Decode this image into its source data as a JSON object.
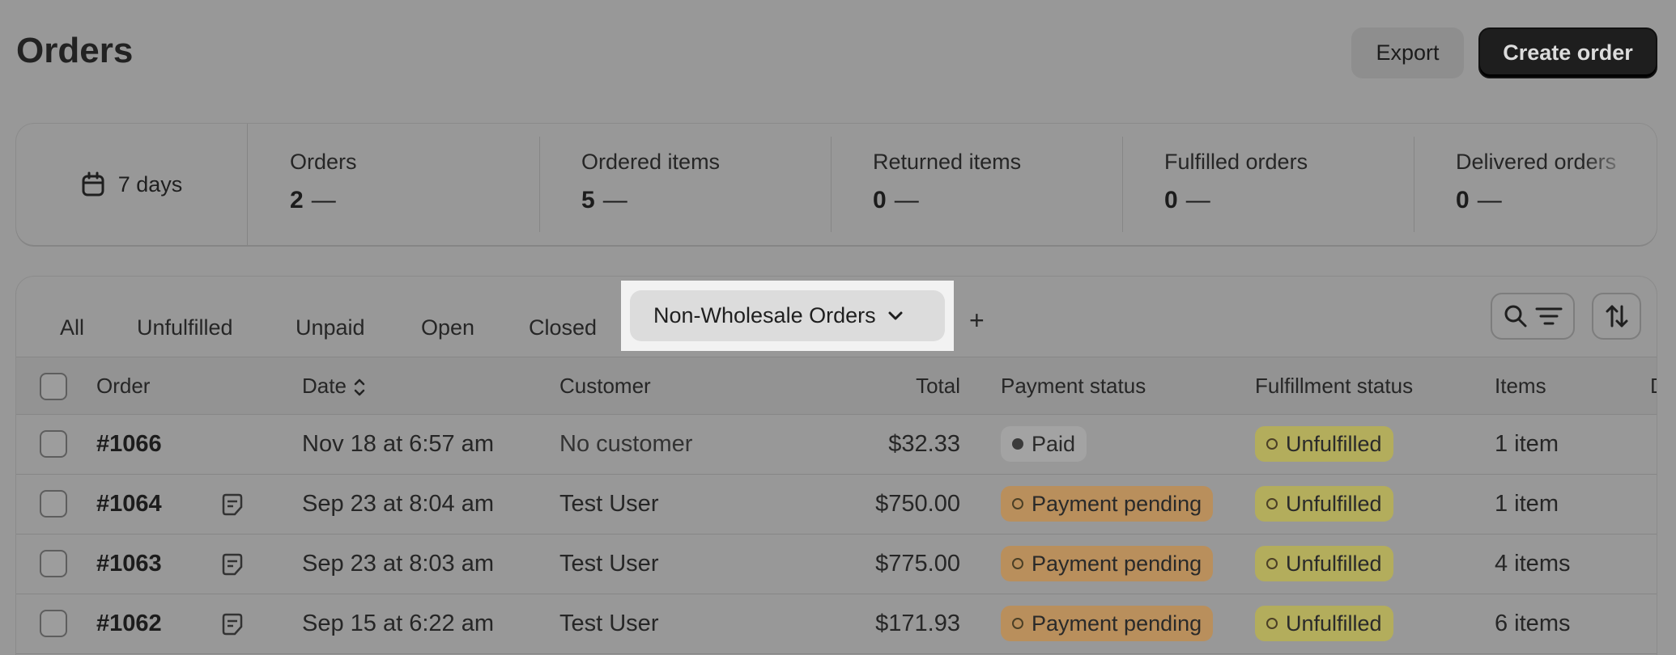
{
  "header": {
    "title": "Orders",
    "export_label": "Export",
    "create_label": "Create order"
  },
  "metrics": {
    "date_range": "7 days",
    "items": [
      {
        "label": "Orders",
        "value": "2",
        "trend": "—"
      },
      {
        "label": "Ordered items",
        "value": "5",
        "trend": "—"
      },
      {
        "label": "Returned items",
        "value": "0",
        "trend": "—"
      },
      {
        "label": "Fulfilled orders",
        "value": "0",
        "trend": "—"
      },
      {
        "label": "Delivered orders",
        "value": "0",
        "trend": "—"
      }
    ]
  },
  "tabs": {
    "all": "All",
    "unfulfilled": "Unfulfilled",
    "unpaid": "Unpaid",
    "open": "Open",
    "closed": "Closed",
    "active": "Non-Wholesale Orders",
    "add": "+"
  },
  "table": {
    "headers": {
      "order": "Order",
      "date": "Date",
      "customer": "Customer",
      "total": "Total",
      "payment": "Payment status",
      "fulfillment": "Fulfillment status",
      "items": "Items",
      "extra": "D"
    },
    "rows": [
      {
        "order": "#1066",
        "date": "Nov 18 at 6:57 am",
        "customer": "No customer",
        "total": "$32.33",
        "payment": "Paid",
        "fulfillment": "Unfulfilled",
        "items": "1 item"
      },
      {
        "order": "#1064",
        "date": "Sep 23 at 8:04 am",
        "customer": "Test User",
        "total": "$750.00",
        "payment": "Payment pending",
        "fulfillment": "Unfulfilled",
        "items": "1 item"
      },
      {
        "order": "#1063",
        "date": "Sep 23 at 8:03 am",
        "customer": "Test User",
        "total": "$775.00",
        "payment": "Payment pending",
        "fulfillment": "Unfulfilled",
        "items": "4 items"
      },
      {
        "order": "#1062",
        "date": "Sep 15 at 6:22 am",
        "customer": "Test User",
        "total": "$171.93",
        "payment": "Payment pending",
        "fulfillment": "Unfulfilled",
        "items": "6 items"
      }
    ]
  },
  "colors": {
    "page_bg": "#989898",
    "paid_badge": "#a3a3a3",
    "pending_badge": "#b98f5c",
    "unfulfilled_badge": "#b3ad5c"
  },
  "icons": {
    "date_range": "calendar-icon",
    "tab_dropdown": "chevron-down-icon",
    "search": "search-icon",
    "filter": "filter-icon",
    "sort": "sort-icon",
    "note": "note-icon"
  }
}
